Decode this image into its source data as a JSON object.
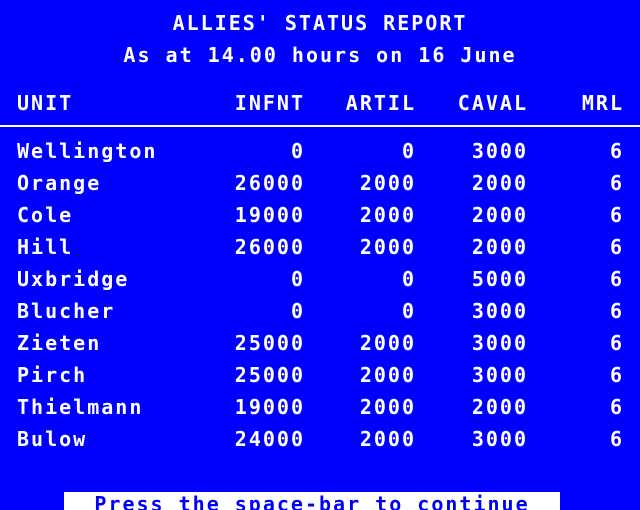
{
  "report": {
    "title": "ALLIES' STATUS REPORT",
    "subtitle": "As at 14.00 hours on 16 June"
  },
  "table": {
    "headers": {
      "unit": "UNIT",
      "infantry": "INFNT",
      "artillery": "ARTIL",
      "cavalry": "CAVAL",
      "morale": "MRL"
    },
    "rows": [
      {
        "unit": "Wellington",
        "infantry": "0",
        "artillery": "0",
        "cavalry": "3000",
        "morale": "6"
      },
      {
        "unit": "Orange",
        "infantry": "26000",
        "artillery": "2000",
        "cavalry": "2000",
        "morale": "6"
      },
      {
        "unit": "Cole",
        "infantry": "19000",
        "artillery": "2000",
        "cavalry": "2000",
        "morale": "6"
      },
      {
        "unit": "Hill",
        "infantry": "26000",
        "artillery": "2000",
        "cavalry": "2000",
        "morale": "6"
      },
      {
        "unit": "Uxbridge",
        "infantry": "0",
        "artillery": "0",
        "cavalry": "5000",
        "morale": "6"
      },
      {
        "unit": "Blucher",
        "infantry": "0",
        "artillery": "0",
        "cavalry": "3000",
        "morale": "6"
      },
      {
        "unit": "Zieten",
        "infantry": "25000",
        "artillery": "2000",
        "cavalry": "3000",
        "morale": "6"
      },
      {
        "unit": "Pirch",
        "infantry": "25000",
        "artillery": "2000",
        "cavalry": "3000",
        "morale": "6"
      },
      {
        "unit": "Thielmann",
        "infantry": "19000",
        "artillery": "2000",
        "cavalry": "2000",
        "morale": "6"
      },
      {
        "unit": "Bulow",
        "infantry": "24000",
        "artillery": "2000",
        "cavalry": "3000",
        "morale": "6"
      }
    ]
  },
  "prompt": {
    "text": "Press the space-bar to continue"
  },
  "colors": {
    "background": "#0000ff",
    "text": "#ffffff"
  }
}
